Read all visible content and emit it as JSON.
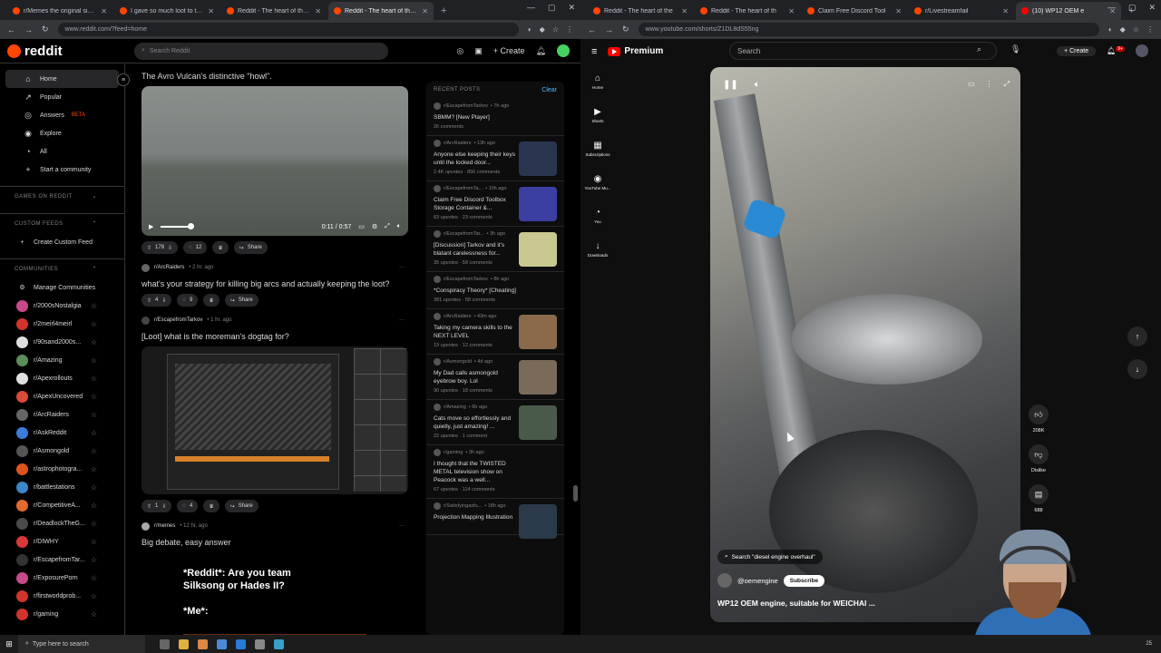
{
  "left_browser": {
    "tabs": [
      {
        "label": "r/Memes the original since 20",
        "color": "#ff4500"
      },
      {
        "label": "I gave so much loot to this guy",
        "color": "#ff4500"
      },
      {
        "label": "Reddit - The heart of the interne",
        "color": "#ff4500"
      },
      {
        "label": "Reddit - The heart of the interne",
        "color": "#ff4500"
      }
    ],
    "url": "www.reddit.com/?feed=home"
  },
  "right_browser": {
    "tabs": [
      {
        "label": "Reddit - The heart of the",
        "color": "#ff4500"
      },
      {
        "label": "Reddit - The heart of th",
        "color": "#ff4500"
      },
      {
        "label": "Claim Free Discord Tool",
        "color": "#ff4500"
      },
      {
        "label": "r/Livestreamfail",
        "color": "#ff4500"
      },
      {
        "label": "(10) WP12 OEM e",
        "color": "#ff0000"
      }
    ],
    "url": "www.youtube.com/shorts/Z1DL8dS55ng"
  },
  "reddit": {
    "logo": "reddit",
    "search_placeholder": "Search Reddit",
    "create_label": "Create",
    "nav": [
      {
        "label": "Home",
        "icon": "⌂",
        "selected": true
      },
      {
        "label": "Popular",
        "icon": "↗"
      },
      {
        "label": "Answers",
        "icon": "◎",
        "badge": "BETA"
      },
      {
        "label": "Explore",
        "icon": "◉"
      },
      {
        "label": "All",
        "icon": "◔"
      },
      {
        "label": "Start a community",
        "icon": "+"
      }
    ],
    "sections": {
      "games": "GAMES ON REDDIT",
      "feeds": "CUSTOM FEEDS",
      "create_feed": "Create Custom Feed",
      "communities": "COMMUNITIES",
      "manage": "Manage Communities"
    },
    "communities": [
      {
        "name": "r/2000sNostalgia",
        "color": "#c94a8a"
      },
      {
        "name": "r/2meirl4meirl",
        "color": "#d0342c"
      },
      {
        "name": "r/90sand2000s...",
        "color": "#dddddd"
      },
      {
        "name": "r/Amazing",
        "color": "#5a8f5a"
      },
      {
        "name": "r/Apexrollouts",
        "color": "#e0e0e0"
      },
      {
        "name": "r/ApexUncovered",
        "color": "#d94b3a"
      },
      {
        "name": "r/ArcRaiders",
        "color": "#666666"
      },
      {
        "name": "r/AskReddit",
        "color": "#3b7dd8"
      },
      {
        "name": "r/Asmongold",
        "color": "#555555"
      },
      {
        "name": "r/astrophotogra...",
        "color": "#e0531f"
      },
      {
        "name": "r/battlestations",
        "color": "#3a87c9"
      },
      {
        "name": "r/CompetitiveA...",
        "color": "#e26a2c"
      },
      {
        "name": "r/DeadlockTheG...",
        "color": "#4a4a4a"
      },
      {
        "name": "r/DIWHY",
        "color": "#d9383a"
      },
      {
        "name": "r/EscapefromTar...",
        "color": "#333333"
      },
      {
        "name": "r/ExposurePorn",
        "color": "#c84a8a"
      },
      {
        "name": "r/firstworldprob...",
        "color": "#d0342c"
      },
      {
        "name": "r/gaming",
        "color": "#d0342c"
      }
    ],
    "posts": [
      {
        "title": "The Avro Vulcan's distinctive \"howl\".",
        "video_time": "0:11 / 0:57",
        "votes": "178",
        "comments": "12",
        "share": "Share"
      },
      {
        "subreddit": "r/ArcRaiders",
        "age": "• 2 hr. ago",
        "title": "what's your strategy for killing big arcs and actually keeping the loot?",
        "votes": "4",
        "comments": "9",
        "share": "Share"
      },
      {
        "subreddit": "r/EscapefromTarkov",
        "age": "• 1 hr. ago",
        "title": "[Loot] what is the moreman's dogtag for?",
        "votes": "1",
        "comments": "4",
        "share": "Share"
      },
      {
        "subreddit": "r/memes",
        "age": "• 12 hr. ago",
        "title": "Big debate, easy answer",
        "meme_text": "*Reddit*: Are you team\nSilksong or Hades II?\n\n*Me*:"
      }
    ],
    "recent": {
      "header": "RECENT POSTS",
      "clear": "Clear",
      "items": [
        {
          "sub": "r/EscapefromTarkov",
          "age": "• 7h ago",
          "title": "SBMM? [New Player]",
          "stats": "26 comments",
          "thumb": ""
        },
        {
          "sub": "r/ArcRaiders",
          "age": "• 13h ago",
          "title": "Anyone else keeping their keys until the locked door...",
          "stats": "2.4K upvotes · 856 comments",
          "thumb": "#2a3550"
        },
        {
          "sub": "r/EscapefromTa...",
          "age": "• 10h ago",
          "title": "Claim Free Discord Toolbox Storage Container &...",
          "stats": "63 upvotes · 23 comments",
          "thumb": "#3a3fa0"
        },
        {
          "sub": "r/EscapefromTar...",
          "age": "• 3h ago",
          "title": "[Discussion] Tarkov and it's blatant carelessness for...",
          "stats": "35 upvotes · 58 comments",
          "thumb": "#c8c890"
        },
        {
          "sub": "r/EscapefromTarkov",
          "age": "• 8h ago",
          "title": "*Conspiracy Theory* [Cheating]",
          "stats": "381 upvotes · 58 comments",
          "thumb": ""
        },
        {
          "sub": "r/ArcRaiders",
          "age": "• 43m ago",
          "title": "Taking my camera skills to the NEXT LEVEL",
          "stats": "19 upvotes · 12 comments",
          "thumb": "#8a6a4a"
        },
        {
          "sub": "r/Asmongold",
          "age": "• 4d ago",
          "title": "My Dad calls asmongold eyebrow boy. Lol",
          "stats": "90 upvotes · 18 comments",
          "thumb": "#7a6a5a"
        },
        {
          "sub": "r/Amazing",
          "age": "• 6h ago",
          "title": "Cats move so effortlessly and quietly, just amazing! ...",
          "stats": "22 upvotes · 1 comment",
          "thumb": "#4a5a4a"
        },
        {
          "sub": "r/gaming",
          "age": "• 3h ago",
          "title": "I thought that the TWISTED METAL television show on Peacock was a well...",
          "stats": "67 upvotes · 114 comments",
          "thumb": ""
        },
        {
          "sub": "r/Satisfyingasfu...",
          "age": "• 18h ago",
          "title": "Projection Mapping Illustration",
          "stats": "",
          "thumb": "#2a3a4a"
        }
      ]
    }
  },
  "youtube": {
    "logo": "Premium",
    "search_placeholder": "Search",
    "create_label": "Create",
    "notif_count": "9+",
    "nav": [
      {
        "label": "Home",
        "icon": "⌂"
      },
      {
        "label": "Shorts",
        "icon": "▶"
      },
      {
        "label": "Subscriptions",
        "icon": "▦"
      },
      {
        "label": "YouTube Mu...",
        "icon": "◉"
      },
      {
        "label": "You",
        "icon": "◔"
      },
      {
        "label": "Downloads",
        "icon": "↓"
      }
    ],
    "short": {
      "search_chip": "Search \"diesel engine overhaul\"",
      "channel": "@oemengine",
      "subscribe": "Subscribe",
      "title": "WP12 OEM engine, suitable for  WEICHAI ...",
      "likes": "208K",
      "dislike": "Dislike",
      "comments": "688"
    }
  },
  "taskbar": {
    "search_placeholder": "Type here to search",
    "tray": "25"
  }
}
